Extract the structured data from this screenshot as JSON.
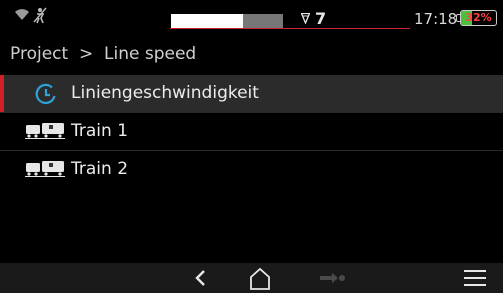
{
  "status_bar": {
    "signal_level": 0.64,
    "satellite_count": "7",
    "time": "17:18",
    "battery_percent": "32%",
    "battery_level": 0.32
  },
  "breadcrumb": {
    "text": "Project  >  Line speed"
  },
  "list": {
    "items": [
      {
        "label": "Liniengeschwindigkeit",
        "icon": "line-speed-icon",
        "selected": true
      },
      {
        "label": "Train 1",
        "icon": "train-icon",
        "selected": false
      },
      {
        "label": "Train 2",
        "icon": "train-icon",
        "selected": false
      }
    ]
  },
  "nav": {
    "buttons": [
      "back-icon",
      "home-icon",
      "forward-icon",
      "menu-icon"
    ]
  },
  "colors": {
    "accent_red": "#d2202a",
    "battery_green": "#4cc13f",
    "selected_row": "#2b2b2b"
  }
}
